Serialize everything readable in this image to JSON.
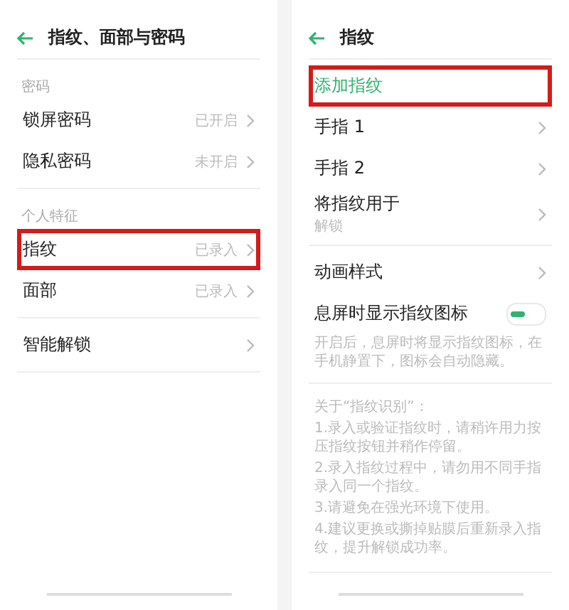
{
  "screens": [
    {
      "title": "指纹、面部与密码",
      "sections": [
        {
          "header": "密码",
          "items": [
            {
              "kind": "link",
              "label": "锁屏密码",
              "value": "已开启",
              "highlighted": false
            },
            {
              "kind": "link",
              "label": "隐私密码",
              "value": "未开启",
              "highlighted": false
            }
          ]
        },
        {
          "header": "个人特征",
          "items": [
            {
              "kind": "link",
              "label": "指纹",
              "value": "已录入",
              "highlighted": true
            },
            {
              "kind": "link",
              "label": "面部",
              "value": "已录入",
              "highlighted": false
            }
          ]
        },
        {
          "items": [
            {
              "kind": "link",
              "label": "智能解锁",
              "highlighted": false
            }
          ]
        }
      ]
    },
    {
      "title": "指纹",
      "sections": [
        {
          "items": [
            {
              "kind": "action",
              "label": "添加指纹",
              "highlighted": true
            },
            {
              "kind": "link",
              "label": "手指 1",
              "highlighted": false
            },
            {
              "kind": "link",
              "label": "手指 2",
              "highlighted": false
            },
            {
              "kind": "link",
              "label": "将指纹用于",
              "subtitle": "解锁",
              "highlighted": false
            }
          ]
        },
        {
          "items": [
            {
              "kind": "link",
              "label": "动画样式",
              "highlighted": false
            },
            {
              "kind": "toggle",
              "label": "息屏时显示指纹图标",
              "on": true,
              "note": "开启后，息屏时将显示指纹图标，在手机静置下，图标会自动隐藏。",
              "highlighted": false
            }
          ]
        },
        {
          "notes_title": "关于“指纹识别”：",
          "notes": [
            "1.录入或验证指纹时，请稍许用力按压指纹按钮并稍作停留。",
            "2.录入指纹过程中，请勿用不同手指录入同一个指纹。",
            "3.请避免在强光环境下使用。",
            "4.建议更换或撕掉贴膜后重新录入指纹，提升解锁成功率。"
          ]
        }
      ]
    }
  ]
}
